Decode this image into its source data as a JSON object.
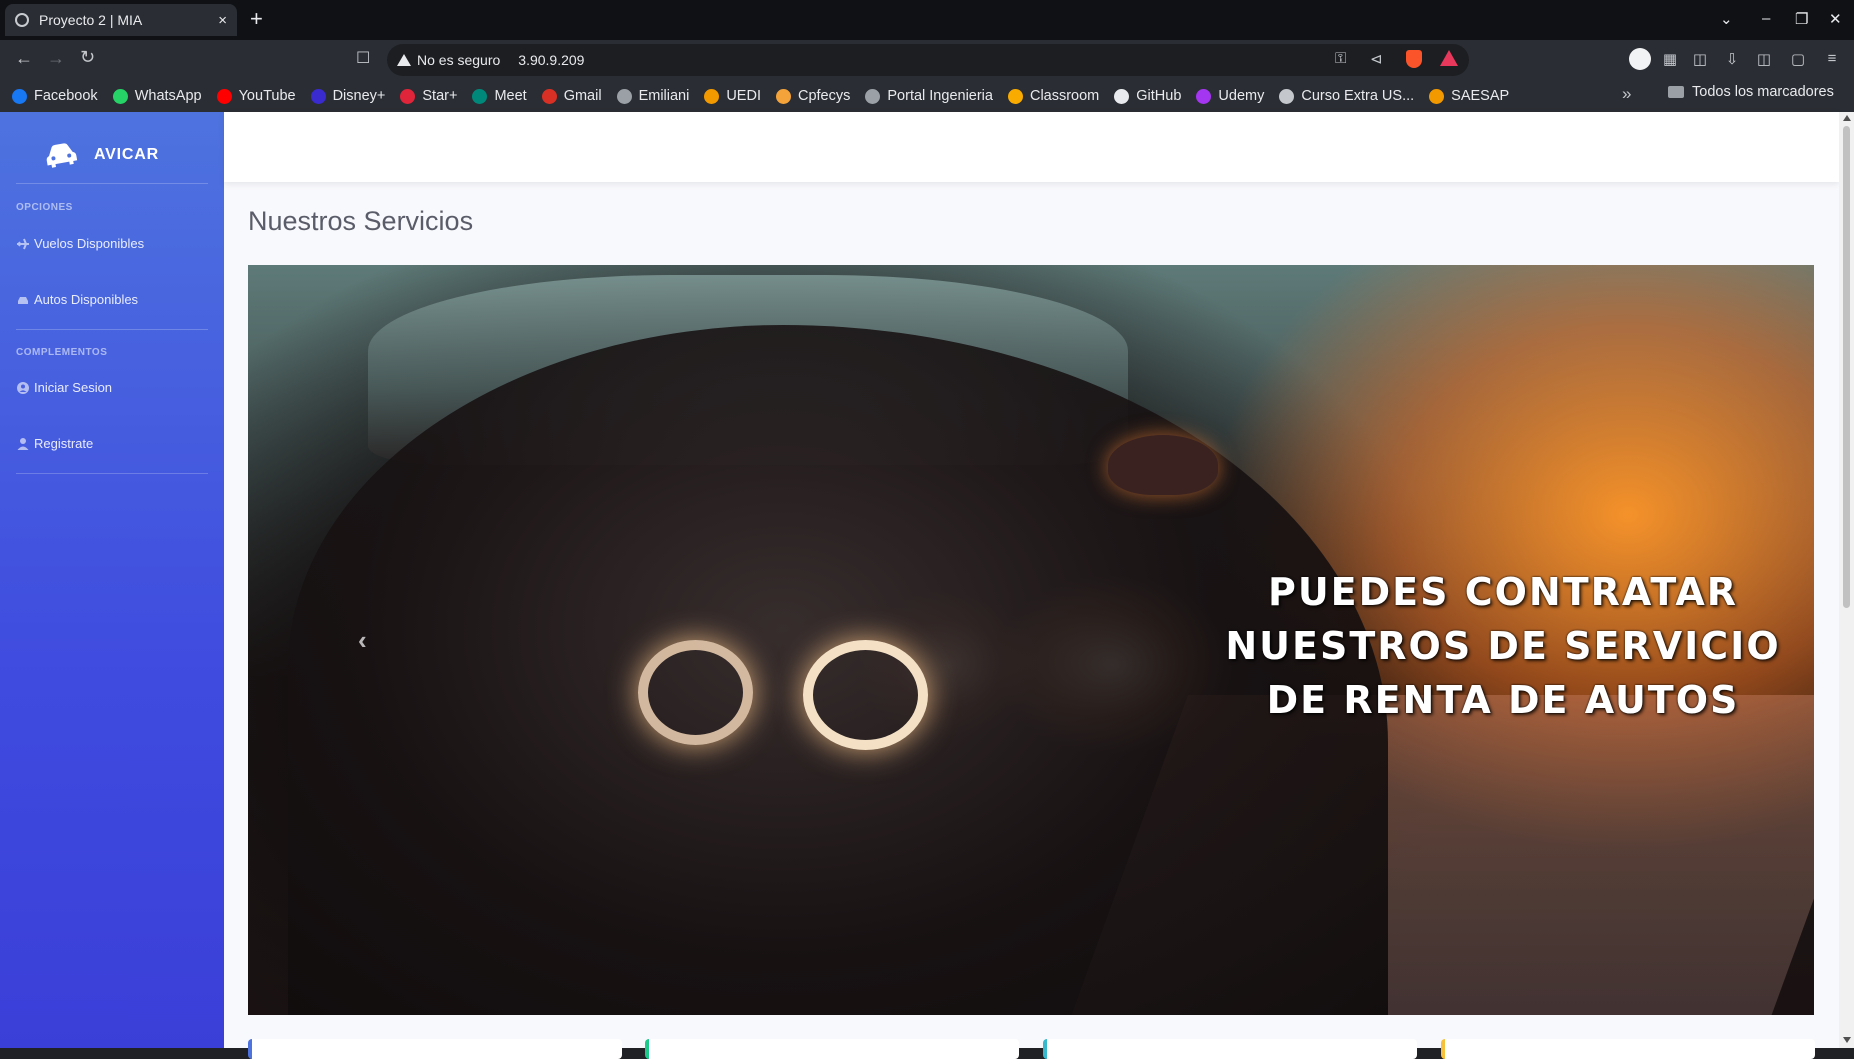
{
  "browser": {
    "tab_title": "Proyecto 2 | MIA",
    "tab_close": "×",
    "new_tab": "+",
    "security_label": "No es seguro",
    "url": "3.90.9.209",
    "window_controls": [
      "⌄",
      "–",
      "❐",
      "✕"
    ]
  },
  "bookmarks": [
    {
      "label": "Facebook",
      "color": "#1877f2"
    },
    {
      "label": "WhatsApp",
      "color": "#25d366"
    },
    {
      "label": "YouTube",
      "color": "#ff0000"
    },
    {
      "label": "Disney+",
      "color": "#3a2bd1"
    },
    {
      "label": "Star+",
      "color": "#e0243a"
    },
    {
      "label": "Meet",
      "color": "#00897b"
    },
    {
      "label": "Gmail",
      "color": "#d93025"
    },
    {
      "label": "Emiliani",
      "color": "#9aa0a6"
    },
    {
      "label": "UEDI",
      "color": "#f29900"
    },
    {
      "label": "Cpfecys",
      "color": "#f4a33a"
    },
    {
      "label": "Portal Ingenieria",
      "color": "#9aa0a6"
    },
    {
      "label": "Classroom",
      "color": "#f9ab00"
    },
    {
      "label": "GitHub",
      "color": "#e8eaed"
    },
    {
      "label": "Udemy",
      "color": "#a435f0"
    },
    {
      "label": "Curso Extra US...",
      "color": "#c4c7cc"
    },
    {
      "label": "SAESAP",
      "color": "#f29900"
    }
  ],
  "bookmarks_more": "»",
  "bookmarks_all": "Todos los marcadores",
  "sidebar": {
    "brand": "AVICAR",
    "heading_options": "OPCIONES",
    "items_options": [
      {
        "label": "Vuelos Disponibles",
        "icon": "plane-icon"
      },
      {
        "label": "Autos Disponibles",
        "icon": "car-icon"
      }
    ],
    "heading_extras": "COMPLEMENTOS",
    "items_extras": [
      {
        "label": "Iniciar Sesion",
        "icon": "user-circle-icon"
      },
      {
        "label": "Registrate",
        "icon": "user-icon"
      }
    ]
  },
  "main": {
    "title": "Nuestros Servicios",
    "carousel": {
      "caption": "PUEDES CONTRATAR NUESTROS DE SERVICIO DE RENTA DE AUTOS",
      "prev_label": "‹"
    },
    "cards": [
      {
        "accent": "#4e73df"
      },
      {
        "accent": "#1cc88a"
      },
      {
        "accent": "#36b9cc"
      },
      {
        "accent": "#f6c23e"
      }
    ]
  },
  "colors": {
    "sidebar_top": "#4e73df",
    "sidebar_bottom": "#3a3fd8",
    "page_bg": "#f8f9fc",
    "title_text": "#5a5c69"
  }
}
